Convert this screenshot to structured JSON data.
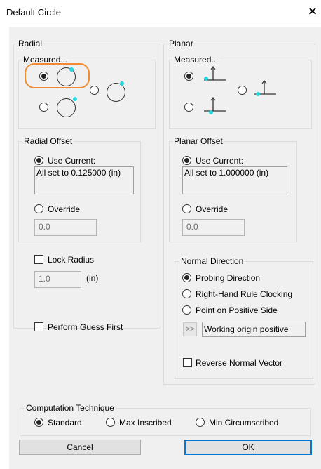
{
  "window": {
    "title": "Default Circle",
    "close_glyph": "✕"
  },
  "radial": {
    "group_label": "Radial",
    "measured_label": "Measured...",
    "offset_label": "Radial Offset",
    "use_current_label": "Use Current:",
    "current_value": "All set to 0.125000 (in)",
    "override_label": "Override",
    "override_value": "0.0",
    "lock_radius_label": "Lock Radius",
    "lock_radius_value": "1.0",
    "lock_radius_unit": "(in)"
  },
  "planar": {
    "group_label": "Planar",
    "measured_label": "Measured...",
    "offset_label": "Planar Offset",
    "use_current_label": "Use Current:",
    "current_value": "All set to 1.000000 (in)",
    "override_label": "Override",
    "override_value": "0.0"
  },
  "normal_direction": {
    "group_label": "Normal Direction",
    "options": [
      "Probing Direction",
      "Right-Hand Rule Clocking",
      "Point on Positive Side"
    ],
    "selected": "Probing Direction",
    "browse_glyph": ">>",
    "origin_value": "Working origin positive",
    "reverse_label": "Reverse Normal Vector"
  },
  "perform_guess_label": "Perform Guess First",
  "computation": {
    "group_label": "Computation Technique",
    "options": [
      "Standard",
      "Max Inscribed",
      "Min Circumscribed"
    ],
    "selected": "Standard"
  },
  "buttons": {
    "cancel": "Cancel",
    "ok": "OK"
  },
  "colors": {
    "point_marker": "#22d7e0",
    "highlight": "#f08b33",
    "default_button_border": "#0078d7"
  }
}
